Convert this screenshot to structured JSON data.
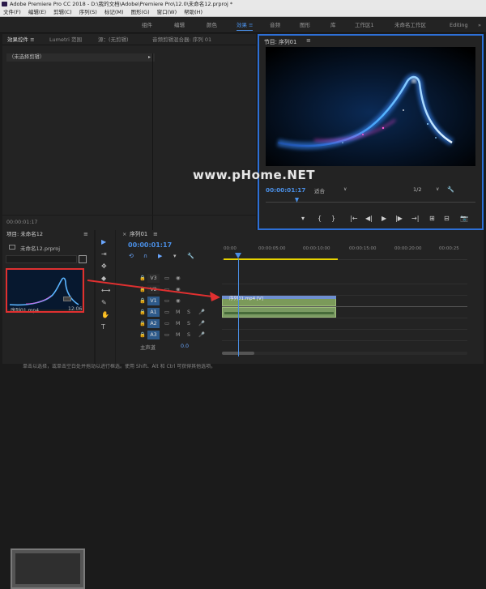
{
  "titlebar": {
    "title": "Adobe Premiere Pro CC 2018 - D:\\我的文档\\Adobe\\Premiere Pro\\12.0\\未命名12.prproj *"
  },
  "menubar": {
    "items": [
      "文件(F)",
      "编辑(E)",
      "剪辑(C)",
      "序列(S)",
      "标记(M)",
      "图形(G)",
      "窗口(W)",
      "帮助(H)"
    ]
  },
  "workspaces": {
    "items": [
      "组件",
      "编辑",
      "颜色",
      "效果",
      "音频",
      "图形",
      "库",
      "工作区1",
      "未命名工作区",
      "Editing"
    ],
    "active_menu_glyph": "≡",
    "overflow": "»"
  },
  "effect_controls": {
    "tabs": [
      "效果控件 ≡",
      "Lumetri 范围",
      "源：(无剪辑)",
      "音频剪辑混合器: 序列 01"
    ],
    "no_selection": "（未选择剪辑）",
    "arrow": "▸",
    "timecode": "00:00:01:17"
  },
  "program_monitor": {
    "title": "节目: 序列01",
    "menu": "≡",
    "watermark": "www.pHome.NET",
    "timecode": "00:00:01:17",
    "fit": "适合",
    "fit_arrow": "∨",
    "scale": "1/2",
    "scale_arrow": "∨",
    "wrench": "🔧",
    "controls": [
      "▾",
      "{",
      "}",
      "|←",
      "◀|",
      "▶",
      "|▶",
      "→|",
      "⊞",
      "⊟",
      "📷"
    ]
  },
  "project": {
    "title": "项目: 未命名12",
    "menu": "≡",
    "file": "未命名12.prproj",
    "thumb1_label": "序列01.mp4",
    "thumb1_duration": "12:06"
  },
  "tools": {
    "items": [
      "▶",
      "⇥",
      "✥",
      "◆",
      "⟷",
      "✎",
      "✋",
      "T"
    ]
  },
  "timeline": {
    "close": "×",
    "title": "序列01",
    "menu": "≡",
    "timecode": "00:00:01:17",
    "icons": [
      "⟲",
      "∩",
      "▶",
      "▾",
      "🔧"
    ],
    "ruler": [
      "00:00",
      "00:00:05:00",
      "00:00:10:00",
      "00:00:15:00",
      "00:00:20:00",
      "00:00:25"
    ],
    "tracks": [
      {
        "name": "V3",
        "active": false,
        "icons": [
          "🔒",
          "▭",
          "◉"
        ]
      },
      {
        "name": "V2",
        "active": false,
        "icons": [
          "🔒",
          "▭",
          "◉"
        ]
      },
      {
        "name": "V1",
        "active": true,
        "icons": [
          "🔒",
          "▭",
          "◉"
        ]
      },
      {
        "name": "A1",
        "active": true,
        "icons": [
          "🔒",
          "▭",
          "M",
          "S",
          "🎤"
        ]
      },
      {
        "name": "A2",
        "active": true,
        "icons": [
          "🔒",
          "▭",
          "M",
          "S",
          "🎤"
        ]
      },
      {
        "name": "A3",
        "active": true,
        "icons": [
          "🔒",
          "▭",
          "M",
          "S",
          "🎤"
        ]
      }
    ],
    "clip_v1_label": "序列01.mp4 [V]",
    "master_label": "主声道",
    "master_value": "0.0"
  },
  "statusbar": {
    "text": "单击以选择，或单击空白处并拖动以进行框选。使用 Shift、Alt 和 Ctrl 可获得其他选项。"
  }
}
